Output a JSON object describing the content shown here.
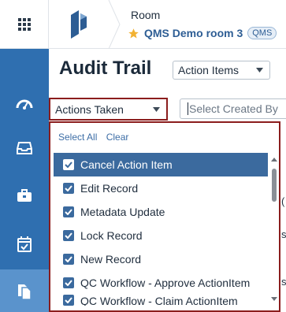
{
  "header": {
    "room_label": "Room",
    "room_name": "QMS Demo room 3",
    "room_badge": "QMS"
  },
  "nav": {
    "items": [
      {
        "icon": "dashboard-icon"
      },
      {
        "icon": "inbox-icon"
      },
      {
        "icon": "briefcase-icon"
      },
      {
        "icon": "calendar-check-icon"
      },
      {
        "icon": "documents-icon",
        "active": true
      }
    ]
  },
  "main": {
    "title": "Audit Trail",
    "type_select": "Action Items",
    "actions_select": "Actions Taken",
    "created_by_placeholder": "Select Created By"
  },
  "dropdown": {
    "select_all": "Select All",
    "clear": "Clear",
    "options": [
      {
        "label": "Cancel Action Item",
        "checked": true,
        "highlighted": true
      },
      {
        "label": "Edit Record",
        "checked": true
      },
      {
        "label": "Metadata Update",
        "checked": true
      },
      {
        "label": "Lock Record",
        "checked": true
      },
      {
        "label": "New Record",
        "checked": true
      },
      {
        "label": "QC Workflow - Approve ActionItem",
        "checked": true
      },
      {
        "label": "QC Workflow - Claim ActionItem",
        "checked": true
      }
    ]
  },
  "colors": {
    "rail": "#2f6fb0",
    "accent": "#2d5d94",
    "highlight": "#3b6a9e",
    "focus_border": "#8b1d1d"
  }
}
